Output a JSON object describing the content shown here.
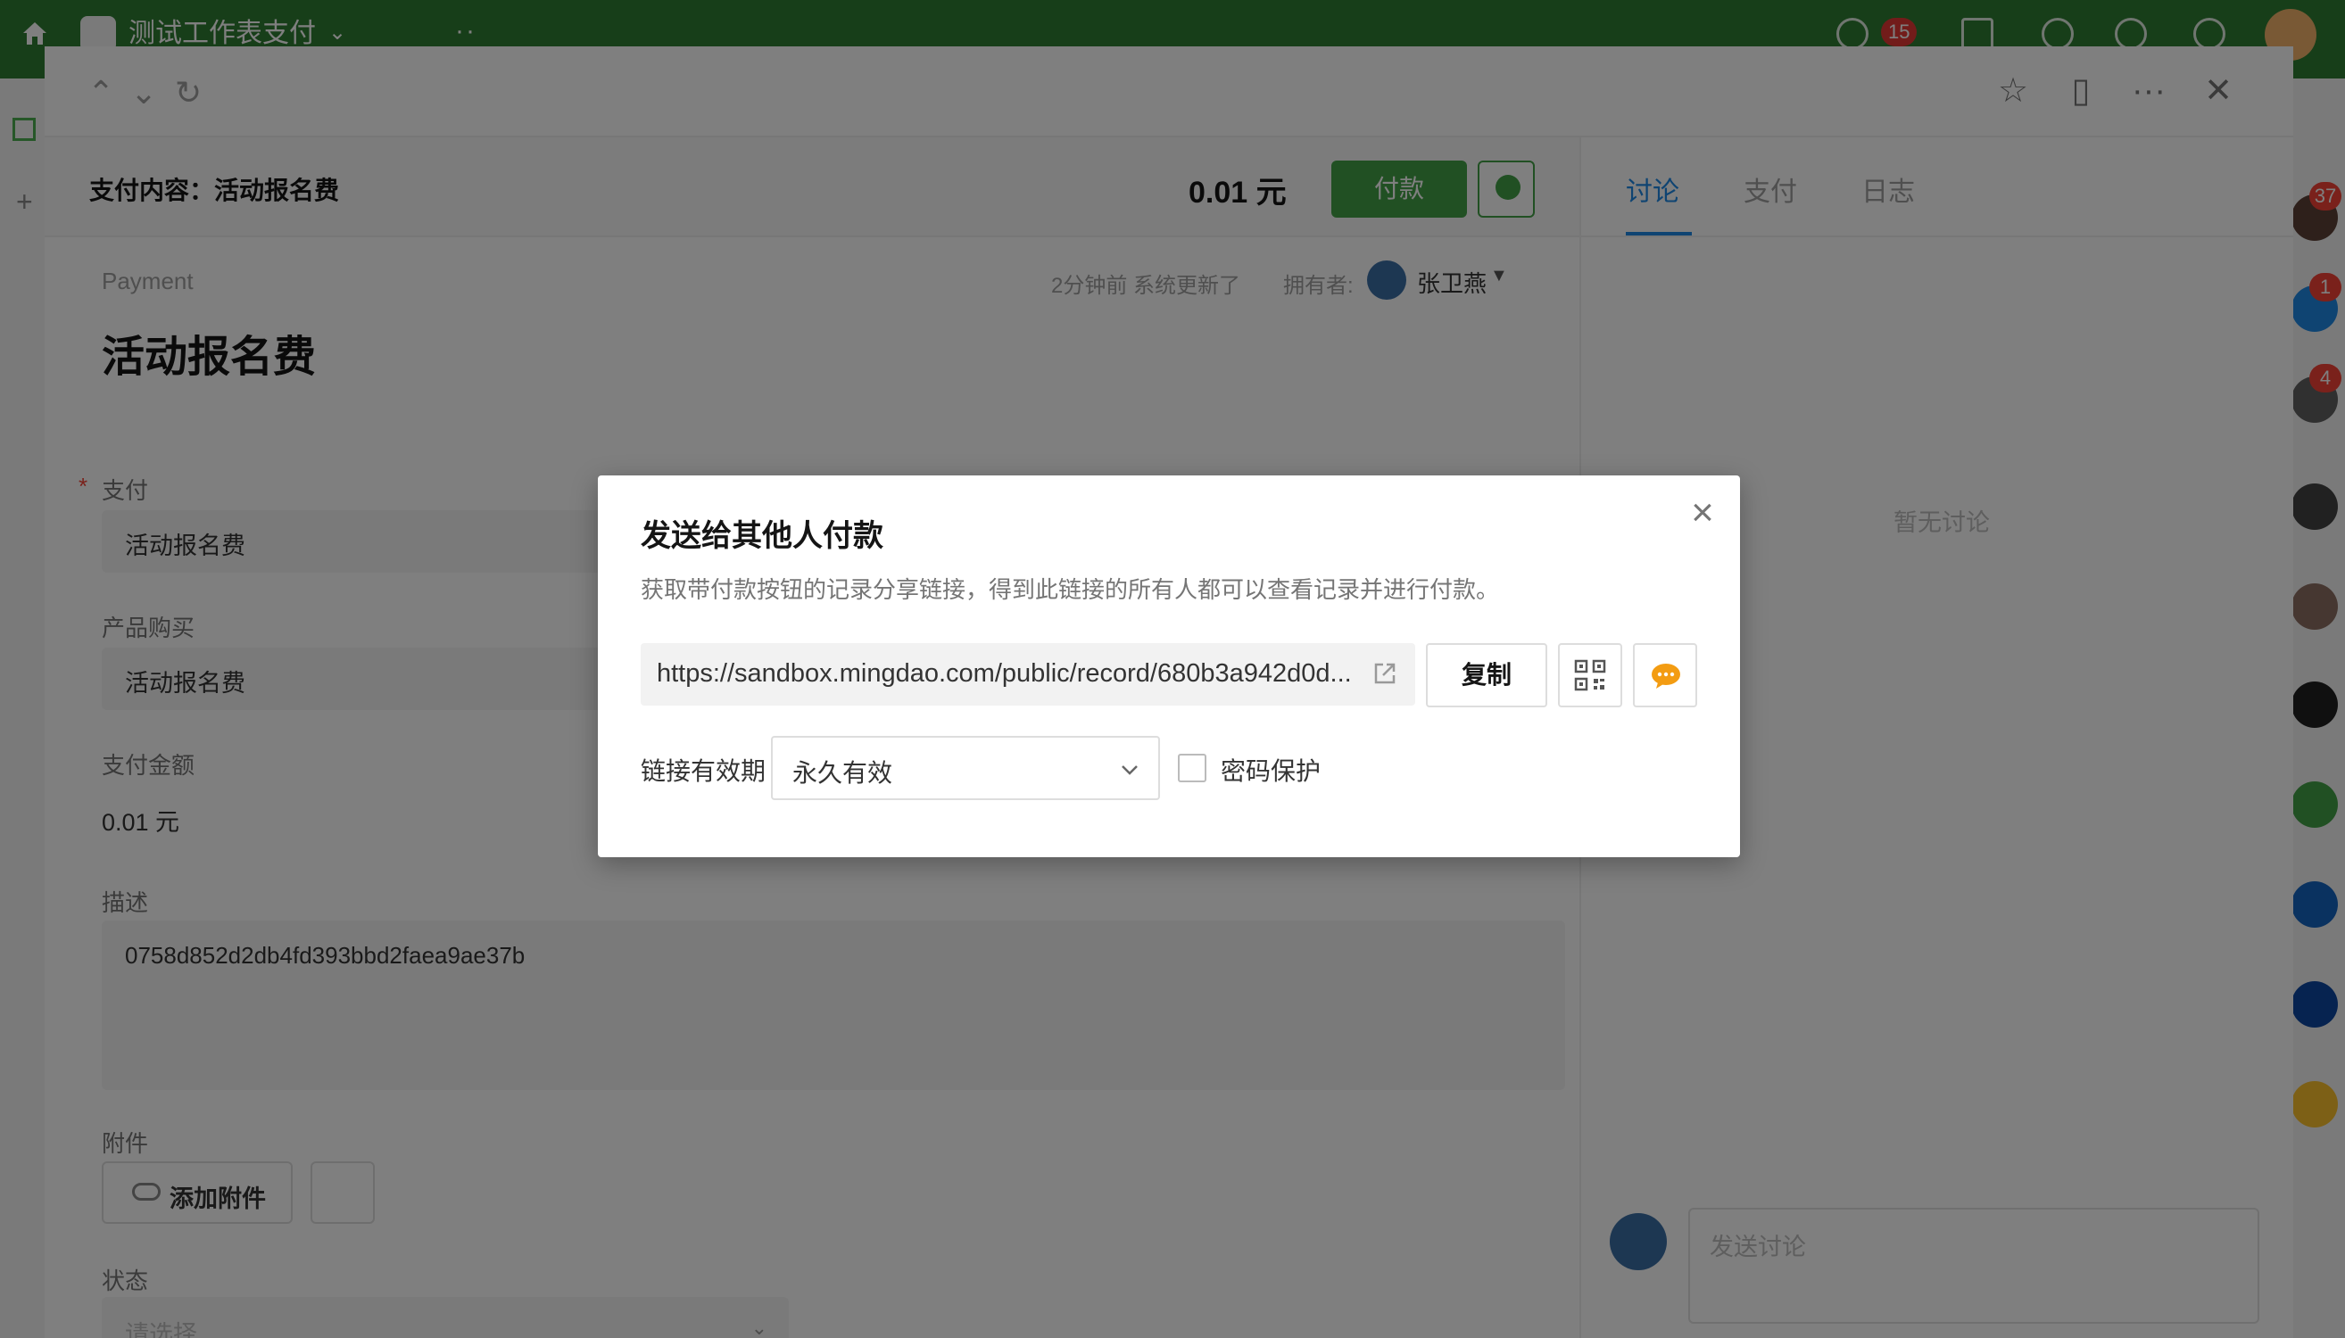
{
  "appbar": {
    "title": "测试工作表支付",
    "badge_count": "15",
    "colors": {
      "bar": "#2e7d32"
    }
  },
  "right_strip": {
    "badges": [
      "37",
      "1",
      "4"
    ]
  },
  "panel_toolbar": {
    "icons": [
      "chevron-up-icon",
      "chevron-down-icon",
      "refresh-icon",
      "star-icon",
      "sidebar-toggle-icon",
      "more-icon",
      "close-icon"
    ]
  },
  "payment_bar": {
    "content": "支付内容：活动报名费",
    "amount": "0.01 元",
    "pay_button": "付款",
    "accent_color": "#43a047"
  },
  "record": {
    "type": "Payment",
    "updated": "2分钟前 系统更新了",
    "owner_label": "拥有者:",
    "owner_name": "张卫燕",
    "title": "活动报名费",
    "fields": {
      "pay_label": "支付",
      "pay_value": "活动报名费",
      "product_label": "产品购买",
      "product_value": "活动报名费",
      "amount_label": "支付金额",
      "amount_value": "0.01 元",
      "desc_label": "描述",
      "desc_value": "0758d852d2db4fd393bbd2faea9ae37b",
      "attach_label": "附件",
      "attach_button": "添加附件",
      "status_label": "状态",
      "status_placeholder": "请选择"
    }
  },
  "side_panel": {
    "tabs": [
      "讨论",
      "支付",
      "日志"
    ],
    "active_tab": 0,
    "empty_text": "暂无讨论",
    "comment_placeholder": "发送讨论",
    "accent_color": "#1e88e5"
  },
  "dialog": {
    "title": "发送给其他人付款",
    "description": "获取带付款按钮的记录分享链接，得到此链接的所有人都可以查看记录并进行付款。",
    "url": "https://sandbox.mingdao.com/public/record/680b3a942d0d...",
    "copy_button": "复制",
    "validity_label": "链接有效期",
    "validity_value": "永久有效",
    "password_label": "密码保护",
    "password_checked": false
  }
}
